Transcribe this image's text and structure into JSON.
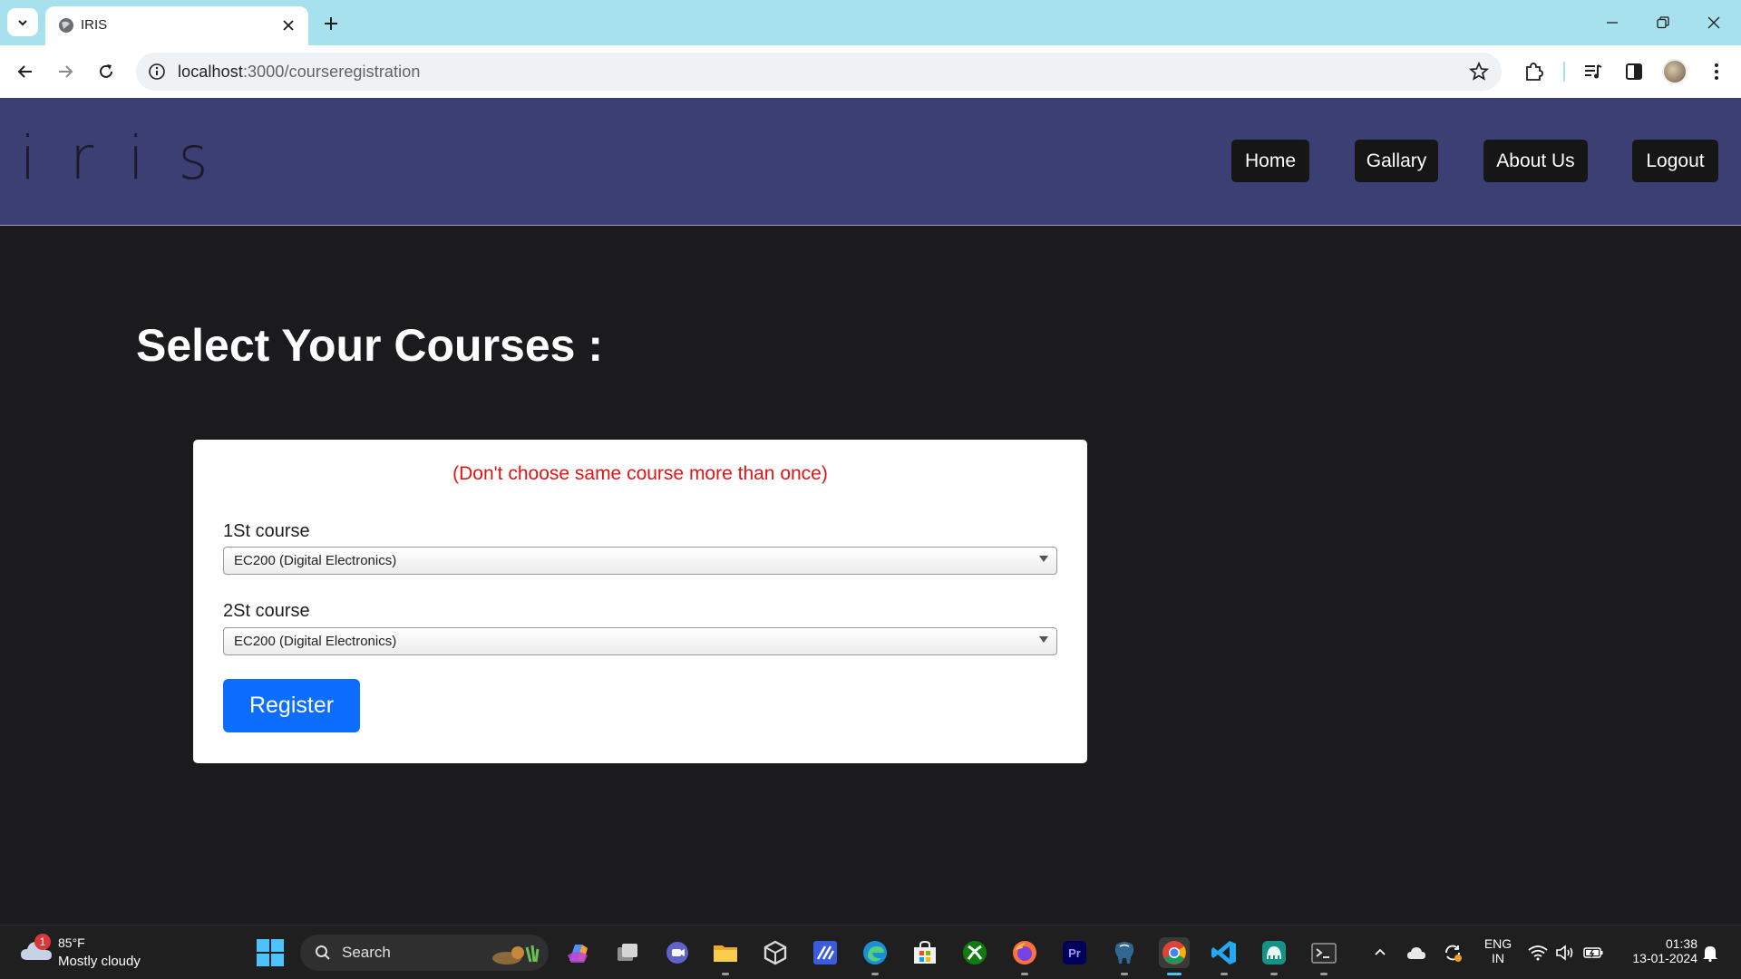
{
  "browser": {
    "tab_title": "IRIS",
    "url_host": "localhost",
    "url_rest": ":3000/courseregistration"
  },
  "site": {
    "logo": "iris",
    "nav": [
      "Home",
      "Gallary",
      "About Us",
      "Logout"
    ]
  },
  "main": {
    "title": "Select Your Courses :",
    "warning": "(Don't choose same course more than once)",
    "fields": [
      {
        "label": "1St course",
        "value": "EC200 (Digital Electronics)"
      },
      {
        "label": "2St course",
        "value": "EC200 (Digital Electronics)"
      }
    ],
    "register_label": "Register"
  },
  "taskbar": {
    "weather_temp": "85°F",
    "weather_desc": "Mostly cloudy",
    "weather_badge": "1",
    "search_label": "Search",
    "lang_top": "ENG",
    "lang_bottom": "IN",
    "time": "01:38",
    "date": "13-01-2024",
    "apps": [
      "copilot-icon",
      "task-view-icon",
      "teams-chat-icon",
      "file-explorer-icon",
      "unity-icon",
      "linear-app-icon",
      "edge-icon",
      "microsoft-store-icon",
      "xbox-icon",
      "firefox-icon",
      "premiere-pro-icon",
      "postgres-icon",
      "chrome-icon",
      "vscode-icon",
      "gitkraken-icon",
      "terminal-icon"
    ]
  },
  "colors": {
    "header_bg": "#3c3f73",
    "page_bg": "#1b1a1c",
    "accent": "#0d6efd",
    "warning": "#e11414",
    "tab_strip": "#a7e1ee"
  }
}
